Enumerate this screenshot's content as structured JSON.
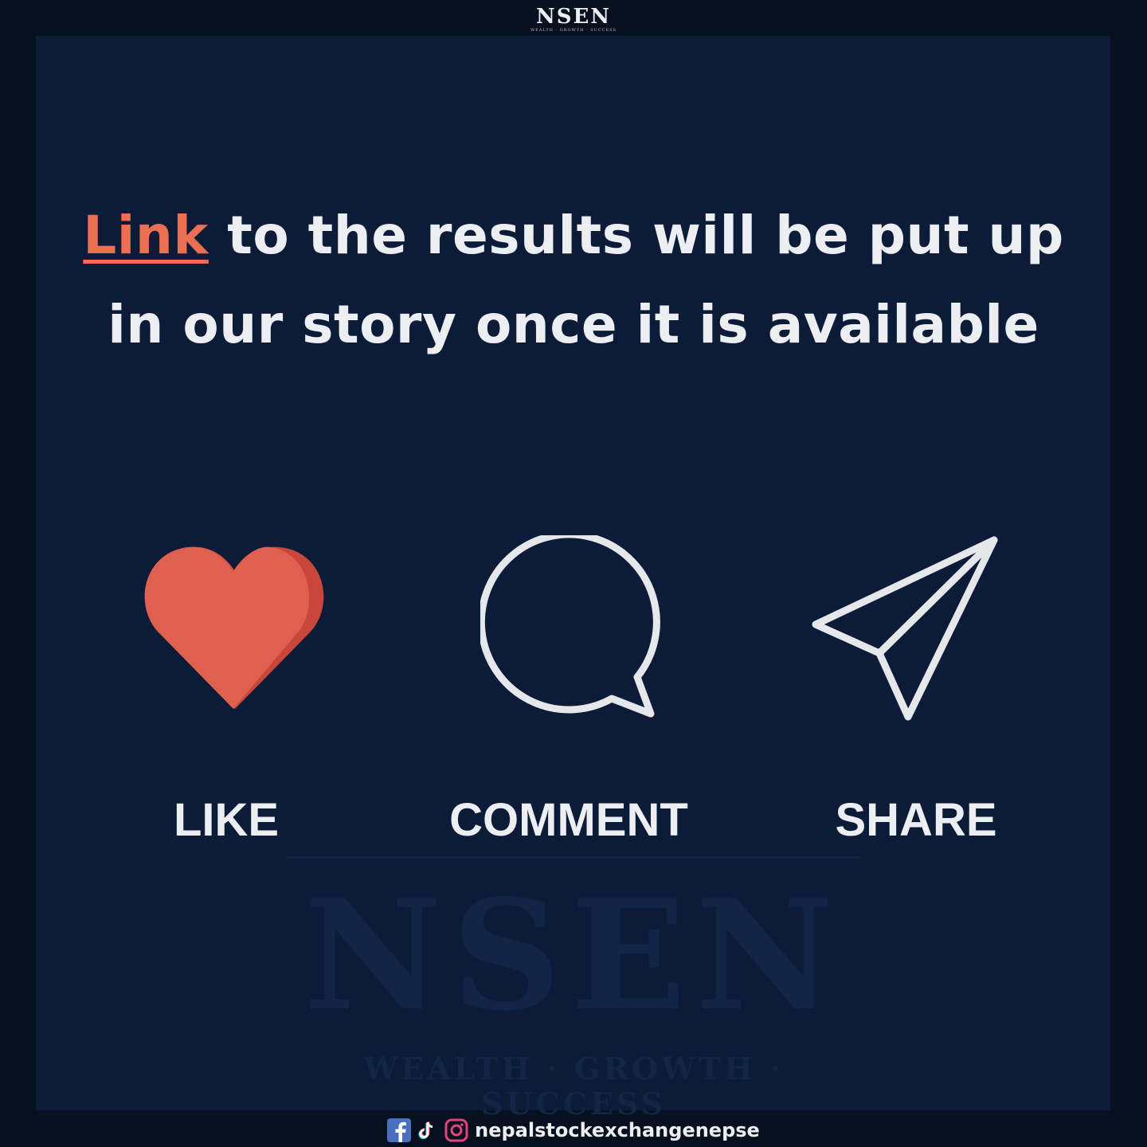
{
  "header": {
    "brand": "NSEN",
    "tagline": "WEALTH · GROWTH · SUCCESS"
  },
  "headline": {
    "highlight": "Link",
    "line1_rest": " to the results will be put up",
    "line2": "in our story once it is available"
  },
  "actions": [
    {
      "label": "LIKE",
      "icon": "heart-icon"
    },
    {
      "label": "COMMENT",
      "icon": "speech-bubble-icon"
    },
    {
      "label": "SHARE",
      "icon": "paper-plane-icon"
    }
  ],
  "watermark": {
    "brand": "NSEN",
    "tagline": "WEALTH · GROWTH · SUCCESS"
  },
  "footer": {
    "handle": "nepalstockexchangenepse",
    "icons": [
      "facebook-icon",
      "tiktok-icon",
      "instagram-icon"
    ]
  },
  "colors": {
    "background": "#0b1b38",
    "accent": "#ec6e53",
    "heart": "#e06050",
    "text": "#eceef2"
  }
}
